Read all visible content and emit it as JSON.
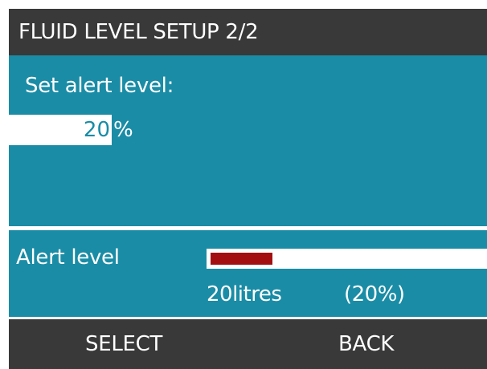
{
  "header": {
    "title": "FLUID LEVEL SETUP 2/2"
  },
  "setting": {
    "prompt": "Set alert level:",
    "value": "20",
    "unit": "%"
  },
  "alert": {
    "label": "Alert level",
    "level_fraction": 0.2,
    "volume_text": "20litres",
    "percent_text": "(20%)",
    "fill_color": "#a30f10"
  },
  "softkeys": {
    "select_label": "SELECT",
    "back_label": "BACK"
  },
  "colors": {
    "background": "#1a8ca6",
    "bars": "#393939"
  }
}
